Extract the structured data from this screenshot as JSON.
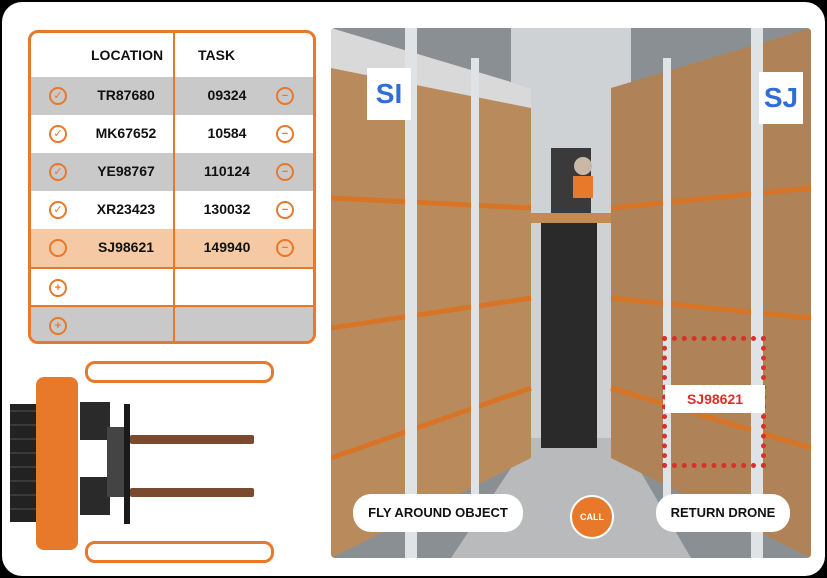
{
  "table": {
    "headers": {
      "location": "LOCATION",
      "task": "TASK"
    },
    "rows": [
      {
        "location": "TR87680",
        "task": "09324",
        "check": "✓",
        "action": "−"
      },
      {
        "location": "MK67652",
        "task": "10584",
        "check": "✓",
        "action": "−"
      },
      {
        "location": "YE98767",
        "task": "110124",
        "check": "✓",
        "action": "−"
      },
      {
        "location": "XR23423",
        "task": "130032",
        "check": "✓",
        "action": "−"
      },
      {
        "location": "SJ98621",
        "task": "149940",
        "check": "",
        "action": "−"
      }
    ],
    "add_rows": [
      {
        "icon": "+"
      },
      {
        "icon": "+"
      }
    ]
  },
  "camera": {
    "aisle_sign_left": "SI",
    "aisle_sign_right": "SJ",
    "target_label": "SJ98621",
    "buttons": {
      "fly_around": "FLY AROUND OBJECT",
      "call": "CALL",
      "return": "RETURN DRONE"
    }
  },
  "colors": {
    "accent": "#e8782a",
    "target": "#d9302a",
    "sign": "#2e6fd6",
    "row_gray": "#c9c9c9",
    "row_selected": "#f5c9a3"
  }
}
